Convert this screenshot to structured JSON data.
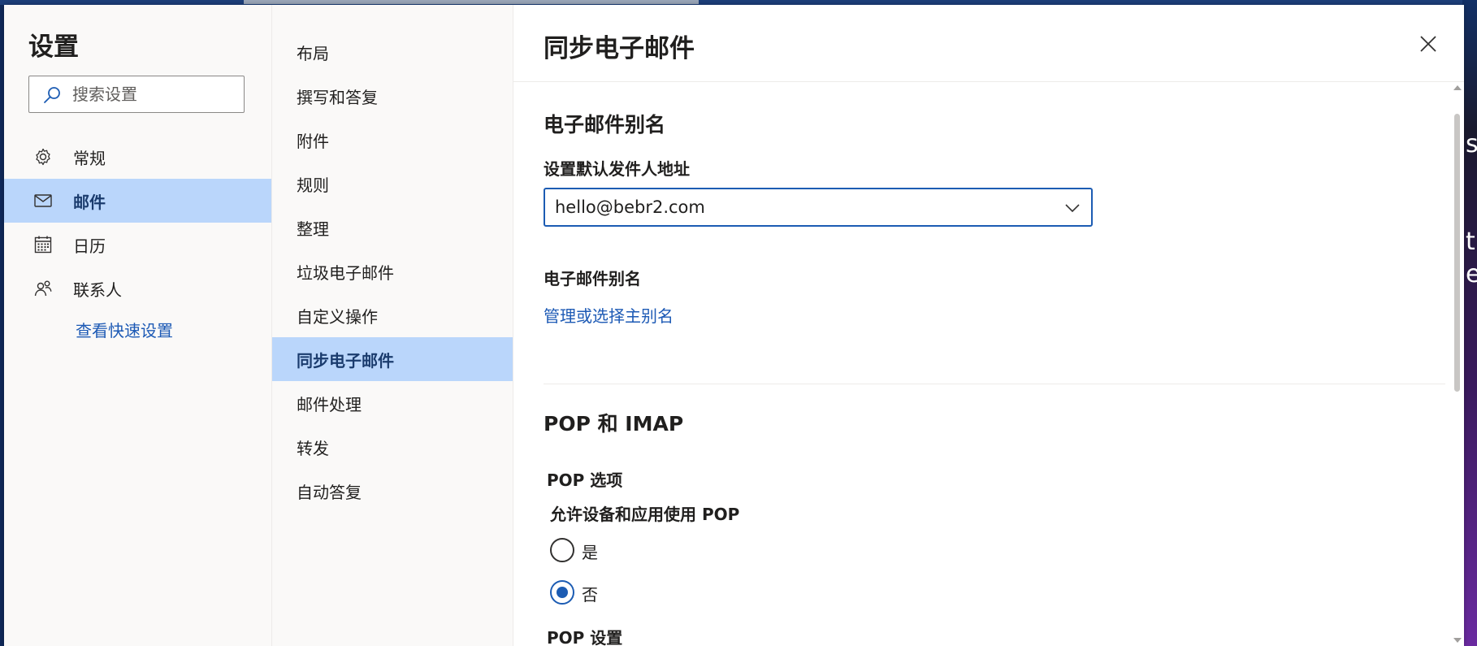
{
  "settings": {
    "title": "设置",
    "search_placeholder": "搜索设置",
    "nav": [
      {
        "label": "常规",
        "icon": "gear-icon"
      },
      {
        "label": "邮件",
        "icon": "mail-icon",
        "selected": true
      },
      {
        "label": "日历",
        "icon": "calendar-icon"
      },
      {
        "label": "联系人",
        "icon": "people-icon"
      }
    ],
    "quick_settings_link": "查看快速设置"
  },
  "categories": [
    {
      "label": "布局"
    },
    {
      "label": "撰写和答复"
    },
    {
      "label": "附件"
    },
    {
      "label": "规则"
    },
    {
      "label": "整理"
    },
    {
      "label": "垃圾电子邮件"
    },
    {
      "label": "自定义操作"
    },
    {
      "label": "同步电子邮件",
      "selected": true
    },
    {
      "label": "邮件处理"
    },
    {
      "label": "转发"
    },
    {
      "label": "自动答复"
    }
  ],
  "content": {
    "title": "同步电子邮件",
    "aliases_section": {
      "title": "电子邮件别名",
      "default_from_label": "设置默认发件人地址",
      "default_from_value": "hello@bebr2.com",
      "aliases_label": "电子邮件别名",
      "manage_link": "管理或选择主别名"
    },
    "pop_imap_section": {
      "title": "POP 和 IMAP",
      "pop_options_label": "POP 选项",
      "allow_pop_label": "允许设备和应用使用 POP",
      "options": [
        {
          "label": "是",
          "checked": false
        },
        {
          "label": "否",
          "checked": true
        }
      ],
      "pop_settings_label": "POP 设置"
    }
  },
  "colors": {
    "accent": "#1c5cb3",
    "selected_bg": "#bad6fb",
    "link": "#1d5ab5"
  }
}
